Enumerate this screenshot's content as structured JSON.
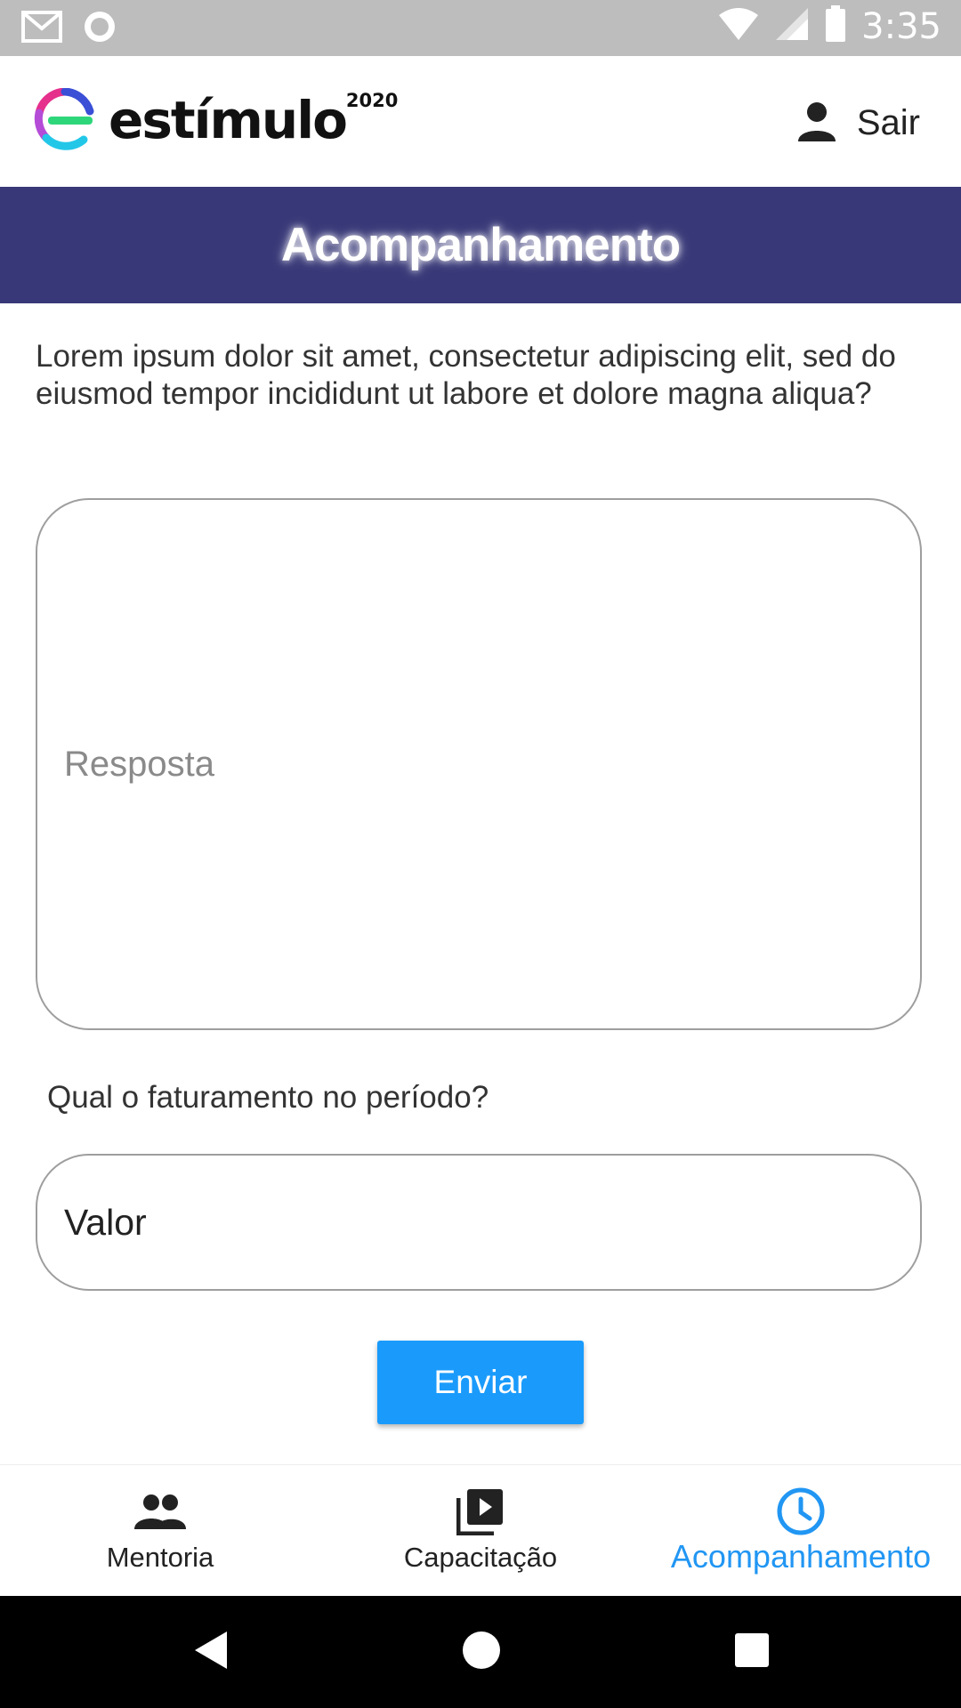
{
  "status_bar": {
    "time": "3:35",
    "icons": [
      "gmail-icon",
      "circle-notification-icon",
      "wifi-icon",
      "signal-icon",
      "battery-icon"
    ]
  },
  "app_bar": {
    "logo_text": "estímulo",
    "logo_year": "2020",
    "logout_label": "Sair"
  },
  "header": {
    "title": "Acompanhamento"
  },
  "form": {
    "question": "Lorem ipsum dolor sit amet, consectetur adipiscing elit, sed do eiusmod tempor incididunt ut labore et dolore magna aliqua?",
    "answer_placeholder": "Resposta",
    "revenue_label": "Qual o faturamento no período?",
    "value_placeholder": "Valor",
    "submit_label": "Enviar"
  },
  "bottom_nav": {
    "items": [
      {
        "label": "Mentoria",
        "icon": "people-icon",
        "active": false
      },
      {
        "label": "Capacitação",
        "icon": "video-library-icon",
        "active": false
      },
      {
        "label": "Acompanhamento",
        "icon": "clock-icon",
        "active": true
      }
    ]
  },
  "colors": {
    "header_bg": "#383878",
    "accent": "#2196f3",
    "button_bg": "#1a9bfc",
    "status_bar_bg": "#bdbdbd"
  }
}
